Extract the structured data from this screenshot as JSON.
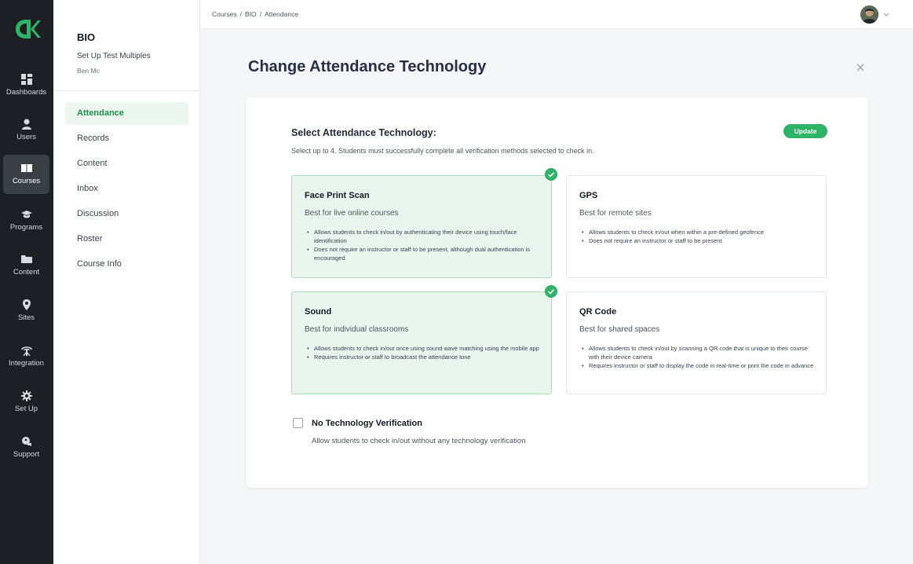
{
  "rail": {
    "items": [
      {
        "label": "Dashboards"
      },
      {
        "label": "Users"
      },
      {
        "label": "Courses"
      },
      {
        "label": "Programs"
      },
      {
        "label": "Content"
      },
      {
        "label": "Sites"
      },
      {
        "label": "Integration"
      },
      {
        "label": "Set Up"
      },
      {
        "label": "Support"
      }
    ],
    "active": "Courses"
  },
  "course": {
    "code": "BIO",
    "name": "Set Up Test Multiples",
    "owner": "Ben Mc"
  },
  "sidebar": {
    "items": [
      {
        "label": "Attendance"
      },
      {
        "label": "Records"
      },
      {
        "label": "Content"
      },
      {
        "label": "Inbox"
      },
      {
        "label": "Discussion"
      },
      {
        "label": "Roster"
      },
      {
        "label": "Course Info"
      }
    ],
    "active": "Attendance"
  },
  "breadcrumb": [
    "Courses",
    "BIO",
    "Attendance"
  ],
  "page": {
    "title": "Change Attendance Technology"
  },
  "selection": {
    "title": "Select Attendance Technology:",
    "subtitle": "Select up to 4. Students must successfully complete all verification methods selected to check in.",
    "update_label": "Update",
    "options": [
      {
        "title": "Face Print Scan",
        "subtitle": "Best for live online courses",
        "bullets": [
          "Allows students to check in/out by authenticating their device using touch/face identification",
          "Does not require an instructor or staff to be present, although dual authentication is encouraged"
        ],
        "selected": true
      },
      {
        "title": "GPS",
        "subtitle": "Best for remote sites",
        "bullets": [
          "Allows students to check in/out when within a pre-defined geofence",
          "Does not require an instructor or staff to be present"
        ],
        "selected": false
      },
      {
        "title": "Sound",
        "subtitle": "Best for individual classrooms",
        "bullets": [
          "Allows students to check in/out once using sound wave matching using the mobile app",
          "Requires instructor or staff to broadcast the attendance tone"
        ],
        "selected": true
      },
      {
        "title": "QR Code",
        "subtitle": "Best for shared spaces",
        "bullets": [
          "Allows students to check in/out by scanning a QR code that is unique to their course with their device camera",
          "Requires instructor or staff to display the code in real-time or print the code in advance"
        ],
        "selected": false
      }
    ],
    "no_tech": {
      "title": "No Technology Verification",
      "subtitle": "Allow students to check in/out without any technology verification",
      "checked": false
    }
  },
  "colors": {
    "accent": "#2db467",
    "selected_bg": "#e9f6ee",
    "rail_bg": "#1c1f24",
    "title": "#273047"
  }
}
